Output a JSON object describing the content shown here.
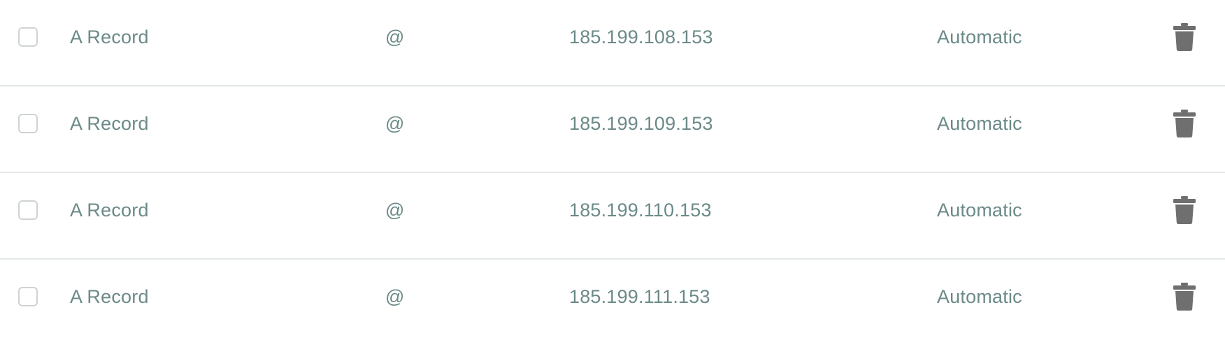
{
  "records": [
    {
      "type": "A Record",
      "host": "@",
      "value": "185.199.108.153",
      "ttl": "Automatic",
      "delete_icon": "trash-icon"
    },
    {
      "type": "A Record",
      "host": "@",
      "value": "185.199.109.153",
      "ttl": "Automatic",
      "delete_icon": "trash-icon"
    },
    {
      "type": "A Record",
      "host": "@",
      "value": "185.199.110.153",
      "ttl": "Automatic",
      "delete_icon": "trash-icon"
    },
    {
      "type": "A Record",
      "host": "@",
      "value": "185.199.111.153",
      "ttl": "Automatic",
      "delete_icon": "trash-icon"
    }
  ],
  "colors": {
    "text": "#6b8a88",
    "divider": "#e4e8e9",
    "checkbox_border": "#cfd3d5",
    "icon": "#6f6f6f"
  }
}
